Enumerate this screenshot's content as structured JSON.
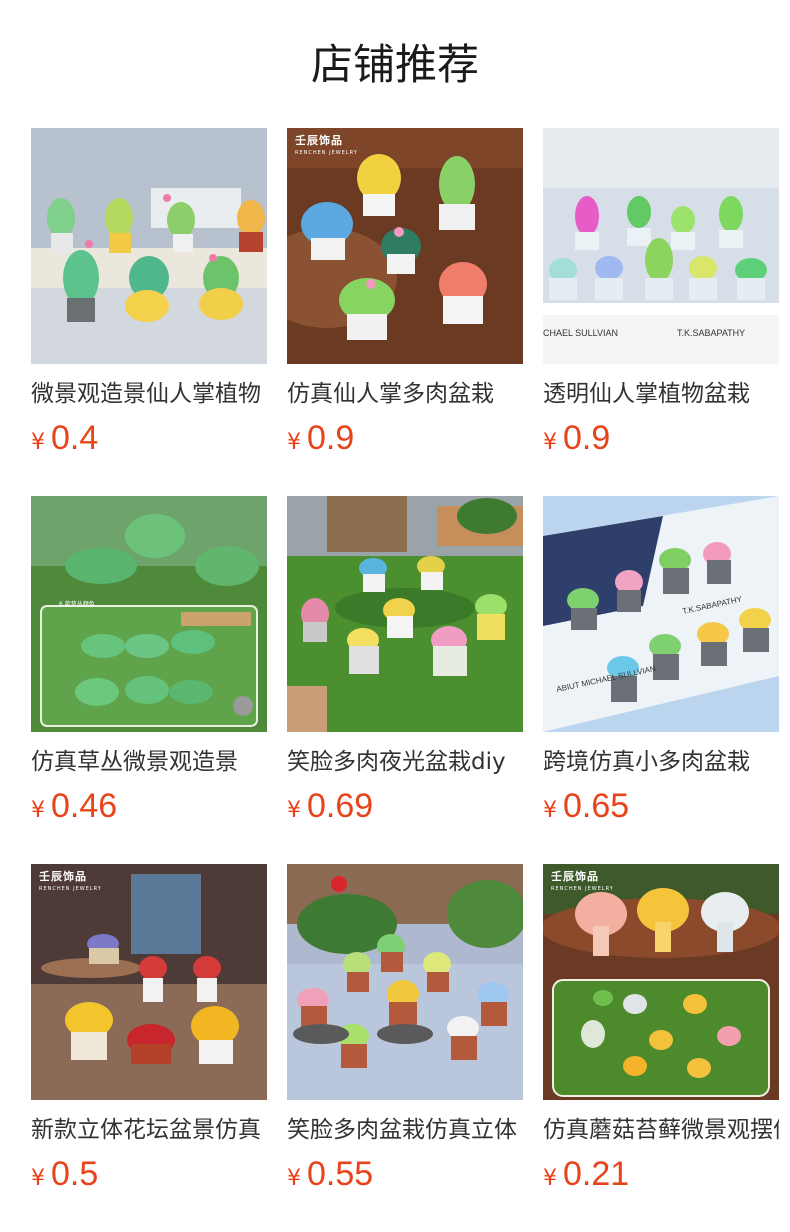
{
  "page_title": "店铺推荐",
  "currency_symbol": "¥",
  "products": [
    {
      "name": "微景观造景仙人掌植物",
      "price": "0.4",
      "image_label": "cactus-pots-photo"
    },
    {
      "name": "仿真仙人掌多肉盆栽",
      "price": "0.9",
      "image_label": "cactus-succulent-photo",
      "watermark": "壬辰饰品",
      "watermark_sub": "RENCHEN JEWELRY"
    },
    {
      "name": "透明仙人掌植物盆栽",
      "price": "0.9",
      "image_label": "clear-cactus-photo",
      "book_text_1": "CHAEL SULLVIAN",
      "book_text_2": "T.K.SABAPATHY"
    },
    {
      "name": "仿真草丛微景观造景",
      "price": "0.46",
      "image_label": "grass-clump-photo",
      "inset_caption": "6 款草丛颜色"
    },
    {
      "name": "笑脸多肉夜光盆栽diy",
      "price": "0.69",
      "image_label": "smiley-succulent-glow-photo"
    },
    {
      "name": "跨境仿真小多肉盆栽",
      "price": "0.65",
      "image_label": "mini-succulent-photo",
      "book_text_1": "ABIUT MICHAEL SULLVIAN",
      "book_text_2": "T.K.SABAPATHY"
    },
    {
      "name": "新款立体花坛盆景仿真",
      "price": "0.5",
      "image_label": "flower-bed-photo",
      "watermark": "壬辰饰品",
      "watermark_sub": "RENCHEN JEWELRY"
    },
    {
      "name": "笑脸多肉盆栽仿真立体",
      "price": "0.55",
      "image_label": "smiley-succulent-pots-photo"
    },
    {
      "name": "仿真蘑菇苔藓微景观摆件",
      "price": "0.21",
      "image_label": "mushroom-moss-photo",
      "watermark": "壬辰饰品",
      "watermark_sub": "RENCHEN JEWELRY"
    }
  ],
  "colors": {
    "price": "#e8441b",
    "title": "#1a1a1a",
    "name": "#333333"
  }
}
